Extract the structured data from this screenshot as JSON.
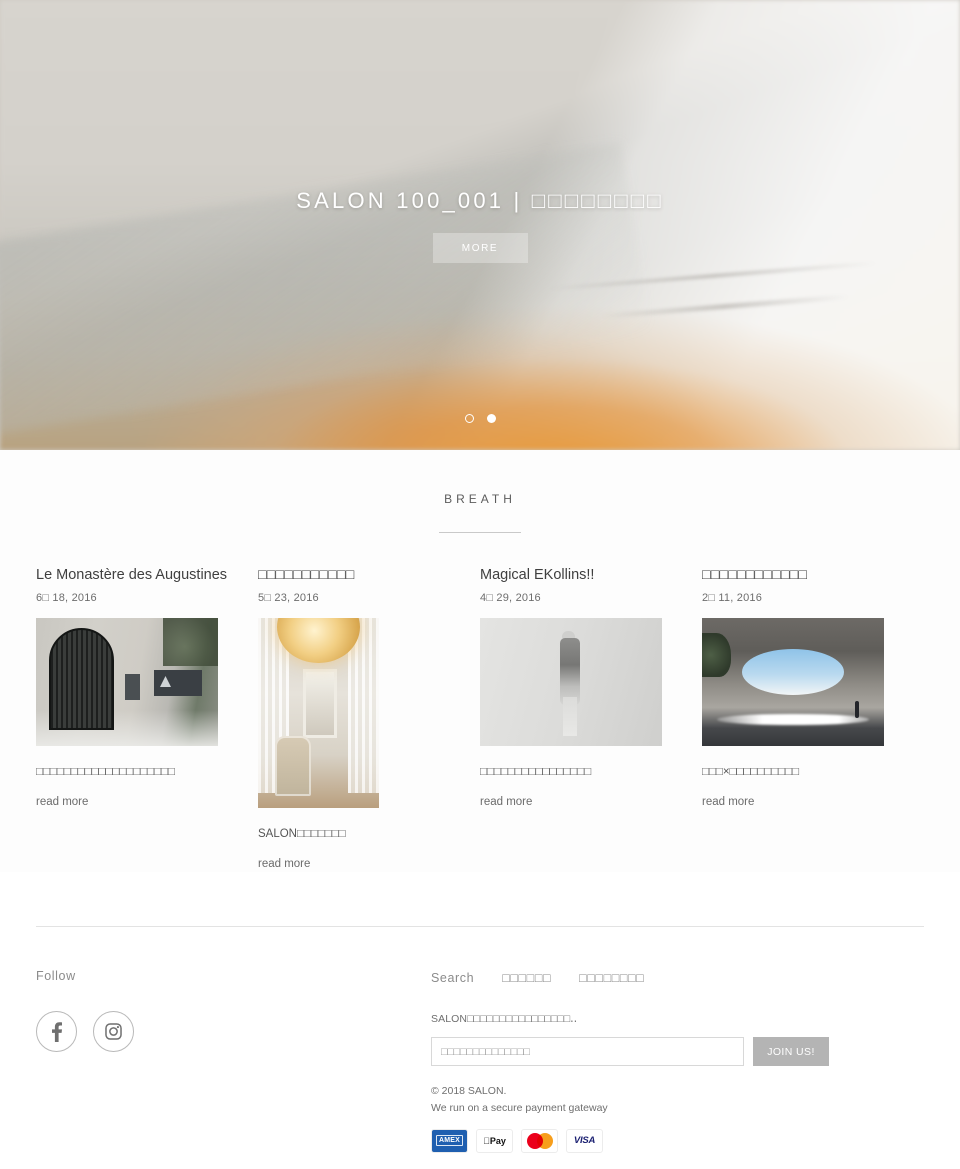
{
  "hero": {
    "title": "SALON 100_001 | □□□□□□□□",
    "more_label": "MORE",
    "dots": [
      "hollow",
      "solid"
    ]
  },
  "section": {
    "title": "BREATH",
    "read_more_label": "read more",
    "cards": [
      {
        "title": "Le Monastère des Augustines",
        "date": "6□ 18, 2016",
        "excerpt": "□□□□□□□□□□□□□□□□□□□□",
        "read_more": "read more",
        "image": "monastere-facade-photo",
        "orientation": "landscape"
      },
      {
        "title": "□□□□□□□□□□□",
        "date": "5□ 23, 2016",
        "excerpt": "SALON□□□□□□□",
        "read_more": "read more",
        "image": "chandelier-interior-photo",
        "orientation": "portrait"
      },
      {
        "title": "Magical EKollins!!",
        "date": "4□ 29, 2016",
        "excerpt": "□□□□□□□□□□□□□□□□",
        "read_more": "read more",
        "image": "mannequin-garment-photo",
        "orientation": "landscape"
      },
      {
        "title": "□□□□□□□□□□□□",
        "date": "2□ 11, 2016",
        "excerpt": "□□□×□□□□□□□□□□",
        "read_more": "read more",
        "image": "teshima-art-museum-photo",
        "orientation": "landscape"
      }
    ]
  },
  "footer": {
    "follow_label": "Follow",
    "social_links": [
      {
        "name": "facebook",
        "label": "f"
      },
      {
        "name": "instagram",
        "label": ""
      }
    ],
    "nav": [
      {
        "label": "Search"
      },
      {
        "label": "□□□□□□"
      },
      {
        "label": "□□□□□□□□"
      }
    ],
    "newsletter": {
      "text": "SALON□□□□□□□□□□□□□□□□‥",
      "placeholder": "□□□□□□□□□□□□□□",
      "value": "",
      "button_label": "JOIN US!"
    },
    "copyright": "© 2018 SALON.",
    "gateway_note": "We run on a secure payment gateway",
    "payments": [
      {
        "name": "amex",
        "label": "AMEX"
      },
      {
        "name": "apple-pay",
        "label": "Pay"
      },
      {
        "name": "mastercard",
        "label": ""
      },
      {
        "name": "visa",
        "label": "VISA"
      }
    ]
  },
  "colors": {
    "accent": "#b4b4b4",
    "text": "#4a4a4a",
    "muted": "#8b8b8b",
    "amex_blue": "#1f5fb0",
    "visa_blue": "#1a1f71",
    "mc_red": "#eb001b",
    "mc_orange": "#f79e1b"
  }
}
